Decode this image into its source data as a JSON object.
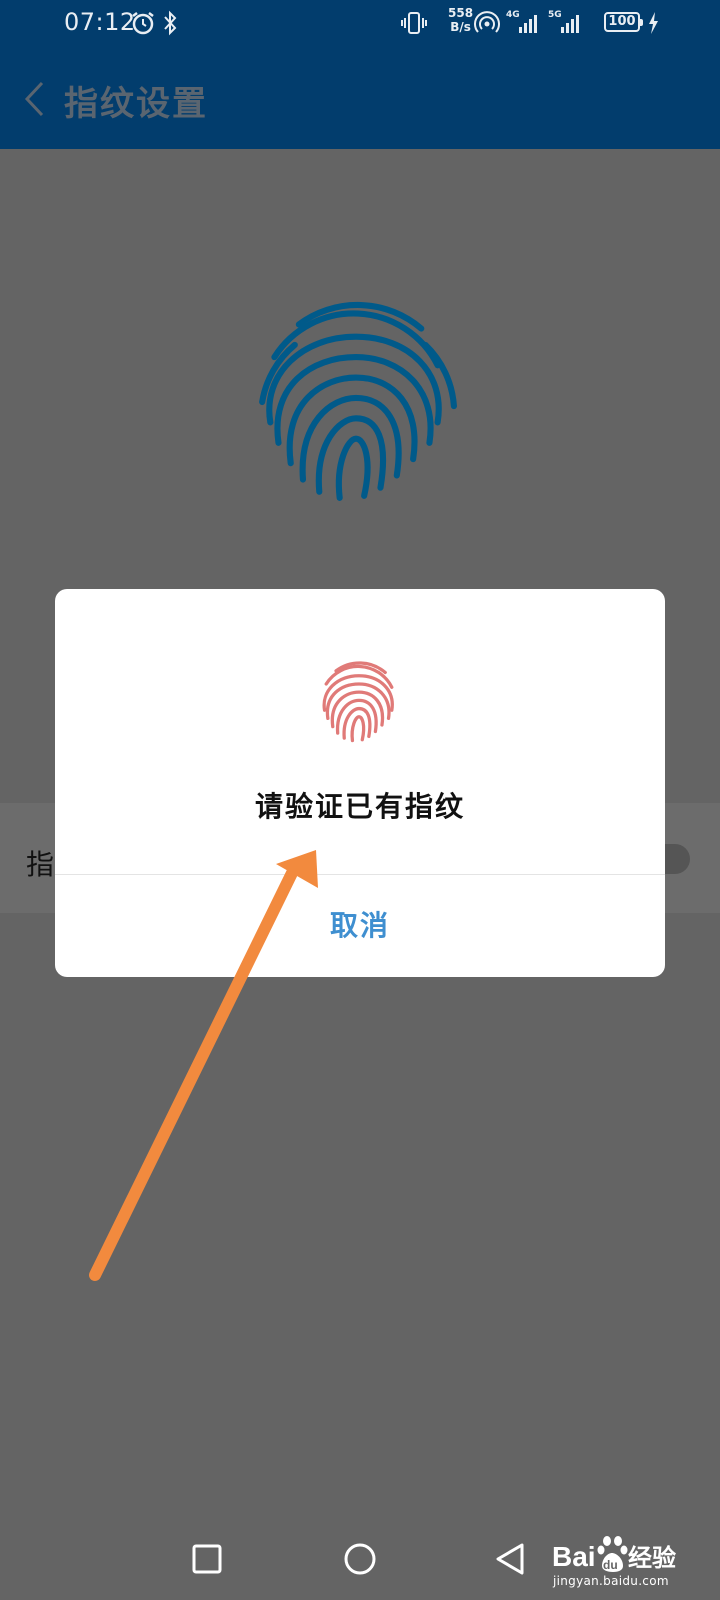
{
  "status_bar": {
    "time": "07:12",
    "speed_value": "558",
    "speed_unit": "B/s",
    "net1": "4G",
    "net2": "5G",
    "battery": "100",
    "icons": [
      "alarm-icon",
      "bluetooth-icon",
      "vibrate-icon",
      "hotspot-icon",
      "signal-4g-icon",
      "signal-5g-icon",
      "battery-icon",
      "charging-icon"
    ]
  },
  "header": {
    "title": "指纹设置",
    "back_icon": "chevron-left-icon"
  },
  "background_row": {
    "label": "指"
  },
  "dialog": {
    "message": "请验证已有指纹",
    "cancel_label": "取消",
    "icon": "fingerprint-icon"
  },
  "nav": {
    "icons": [
      "recents-icon",
      "home-icon",
      "back-icon"
    ]
  },
  "watermark": {
    "logo_text_a": "Bai",
    "logo_text_b": "du",
    "logo_text_c": "经验",
    "url": "jingyan.baidu.com"
  },
  "colors": {
    "header_bg": "#023d6d",
    "fingerprint_primary": "#005a8a",
    "fingerprint_dialog": "#e07a78",
    "cancel_text": "#3f8fd0",
    "annotation_arrow": "#f28a3e",
    "overlay": "#646464"
  }
}
